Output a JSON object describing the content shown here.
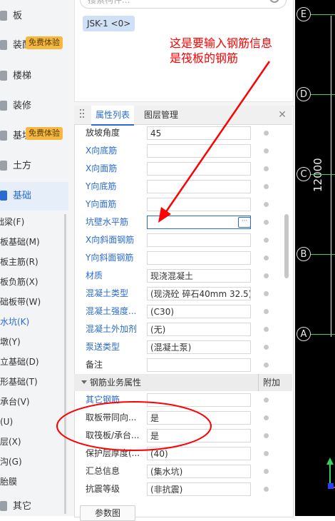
{
  "nav": {
    "categories": [
      {
        "label": "板",
        "active": false
      },
      {
        "label": "装配式",
        "active": false,
        "badge": "免费体验"
      },
      {
        "label": "楼梯",
        "active": false
      },
      {
        "label": "装修",
        "active": false
      },
      {
        "label": "基坑支护",
        "active": false,
        "badge": "免费体验"
      },
      {
        "label": "土方",
        "active": false
      },
      {
        "label": "基础",
        "active": true
      }
    ],
    "subitems": [
      "基础梁(F)",
      "筏板基础(M)",
      "筏板主筋(R)",
      "筏板负筋(X)",
      "基础板带(W)",
      "集水坑(K)",
      "柱墩(Y)",
      "独立基础(D)",
      "条形基础(T)",
      "桩承台(V)",
      "桩(U)",
      "垫层(X)",
      "地沟(G)",
      "砖胎膜"
    ],
    "active_sub_index": 5,
    "other_label": "其它"
  },
  "search": {
    "placeholder": "搜索构件..."
  },
  "component_tag": "JSK-1 <0>",
  "tabs": {
    "properties": "属性列表",
    "layers": "图层管理",
    "close": "✕"
  },
  "properties": [
    {
      "name": "放坡角度",
      "value": "45",
      "blue": false
    },
    {
      "name": "X向底筋",
      "value": "",
      "blue": true
    },
    {
      "name": "X向面筋",
      "value": "",
      "blue": true
    },
    {
      "name": "Y向底筋",
      "value": "",
      "blue": true
    },
    {
      "name": "Y向面筋",
      "value": "",
      "blue": true
    },
    {
      "name": "坑壁水平筋",
      "value": "",
      "blue": true,
      "focused": true
    },
    {
      "name": "X向斜面钢筋",
      "value": "",
      "blue": true
    },
    {
      "name": "Y向斜面钢筋",
      "value": "",
      "blue": true
    },
    {
      "name": "材质",
      "value": "现浇混凝土",
      "blue": true
    },
    {
      "name": "混凝土类型",
      "value": "(现浇砼 碎石40mm 32.5)",
      "blue": true
    },
    {
      "name": "混凝土强度...",
      "value": "(C30)",
      "blue": true
    },
    {
      "name": "混凝土外加剂",
      "value": "(无)",
      "blue": true
    },
    {
      "name": "泵送类型",
      "value": "(混凝土泵)",
      "blue": true
    },
    {
      "name": "备注",
      "value": "",
      "blue": false
    }
  ],
  "rebar_group": {
    "title": "钢筋业务属性",
    "attach_label": "附加",
    "rows": [
      {
        "name": "其它钢筋",
        "value": "",
        "blue": true
      },
      {
        "name": "取板带同向...",
        "value": "是",
        "blue": false
      },
      {
        "name": "取筏板/承台...",
        "value": "是",
        "blue": false
      },
      {
        "name": "保护层厚度(...",
        "value": "(40)",
        "blue": false
      },
      {
        "name": "汇总信息",
        "value": "(集水坑)",
        "blue": false
      },
      {
        "name": "抗震等级",
        "value": "(非抗震)",
        "blue": false
      }
    ]
  },
  "bottom_button": "参数图",
  "cad": {
    "axes": [
      "E",
      "D",
      "C",
      "B",
      "A"
    ],
    "dimension": "12000"
  },
  "annotation": {
    "line1": "这是要输入钢筋信息",
    "line2": "是筏板的钢筋"
  },
  "colors": {
    "accent": "#2a6bd1",
    "annotation": "#ff0000",
    "badge": "#f5b941",
    "axis_line": "#2fd35d"
  }
}
